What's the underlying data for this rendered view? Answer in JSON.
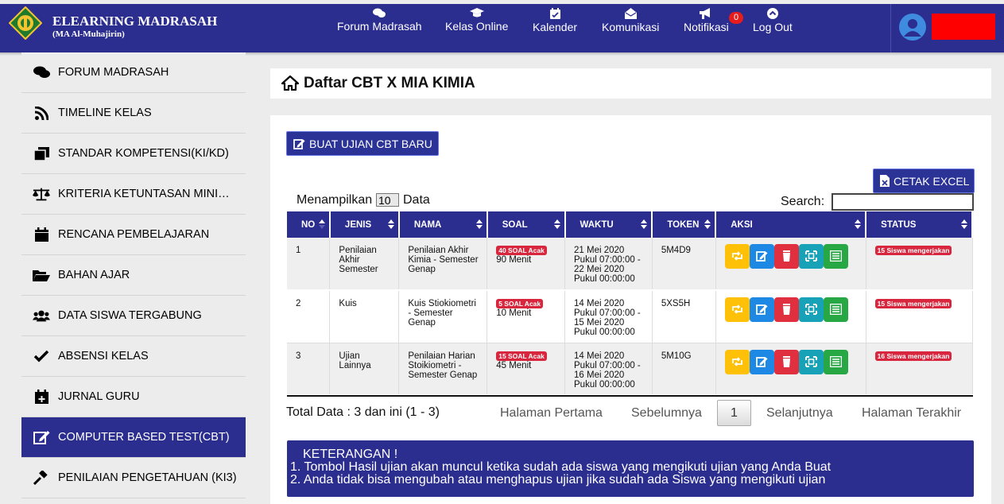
{
  "brand": {
    "title": "ELEARNING MADRASAH",
    "subtitle": "(MA Al-Muhajirin)"
  },
  "nav": {
    "items": [
      {
        "label": "Forum Madrasah",
        "icon": "comments-icon"
      },
      {
        "label": "Kelas Online",
        "icon": "graduation-cap-icon"
      },
      {
        "label": "Kalender",
        "icon": "calendar-check-icon"
      },
      {
        "label": "Komunikasi",
        "icon": "envelope-open-icon"
      },
      {
        "label": "Notifikasi",
        "icon": "bullhorn-icon"
      },
      {
        "label": "Log Out",
        "icon": "chevron-circle-up-icon"
      }
    ],
    "notif_count": "0"
  },
  "sidebar": {
    "items": [
      {
        "label": "FORUM MADRASAH",
        "icon": "comments-icon"
      },
      {
        "label": "TIMELINE KELAS",
        "icon": "rss-icon"
      },
      {
        "label": "STANDAR KOMPETENSI(KI/KD)",
        "icon": "clone-icon"
      },
      {
        "label": "KRITERIA KETUNTASAN MINI…",
        "icon": "balance-scale-icon"
      },
      {
        "label": "RENCANA PEMBELAJARAN",
        "icon": "calendar-icon"
      },
      {
        "label": "BAHAN AJAR",
        "icon": "folder-open-icon"
      },
      {
        "label": "DATA SISWA TERGABUNG",
        "icon": "users-icon"
      },
      {
        "label": "ABSENSI KELAS",
        "icon": "check-icon"
      },
      {
        "label": "JURNAL GURU",
        "icon": "calendar-plus-icon"
      },
      {
        "label": "COMPUTER BASED TEST(CBT)",
        "icon": "edit-icon",
        "active": true
      },
      {
        "label": "PENILAIAN PENGETAHUAN (KI3)",
        "icon": "gavel-icon"
      }
    ]
  },
  "page": {
    "title": "Daftar CBT X MIA KIMIA"
  },
  "toolbar": {
    "new_label": "BUAT UJIAN CBT BARU",
    "excel_label": "CETAK EXCEL"
  },
  "table_controls": {
    "show_prefix": "Menampilkan",
    "show_value": "10",
    "show_suffix": "Data",
    "search_label": "Search:"
  },
  "table": {
    "headers": [
      "NO",
      "JENIS",
      "NAMA",
      "SOAL",
      "WAKTU",
      "TOKEN",
      "AKSI",
      "STATUS"
    ],
    "rows": [
      {
        "no": "1",
        "jenis": "Penilaian Akhir Semester",
        "nama": "Penilaian Akhir Kimia - Semester Genap",
        "soal_badge": "40 SOAL Acak",
        "soal_menit": "90 Menit",
        "waktu": "21 Mei 2020 Pukul 07:00:00 - 22 Mei 2020 Pukul 00:00:00",
        "token": "5M4D9",
        "status": "15 Siswa mengerjakan"
      },
      {
        "no": "2",
        "jenis": "Kuis",
        "nama": "Kuis Stiokiometri - Semester Genap",
        "soal_badge": "5 SOAL Acak",
        "soal_menit": "10 Menit",
        "waktu": "14 Mei 2020 Pukul 07:00:00 - 15 Mei 2020 Pukul 00:00:00",
        "token": "5XS5H",
        "status": "15 Siswa mengerjakan"
      },
      {
        "no": "3",
        "jenis": "Ujian Lainnya",
        "nama": "Penilaian Harian Stoikiometri - Semester Genap",
        "soal_badge": "15 SOAL Acak",
        "soal_menit": "45 Menit",
        "waktu": "14 Mei 2020 Pukul 07:00:00 - 16 Mei 2020 Pukul 00:00:00",
        "token": "5M10G",
        "status": "16 Siswa mengerjakan"
      }
    ]
  },
  "footer": {
    "total": "Total Data : 3 dan ini (1 - 3)",
    "first": "Halaman Pertama",
    "prev": "Sebelumnya",
    "current": "1",
    "next": "Selanjutnya",
    "last": "Halaman Terakhir"
  },
  "note": {
    "title": "KETERANGAN !",
    "line1": "1. Tombol Hasil ujian akan muncul ketika sudah ada siswa yang mengikuti ujian yang Anda Buat",
    "line2": "2. Anda tidak bisa mengubah atau menghapus ujian jika sudah ada Siswa yang mengikuti ujian"
  },
  "colors": {
    "primary": "#2b2d8f",
    "danger": "#d7263d",
    "warning": "#ffc107",
    "info": "#17a2b8",
    "success": "#28a745",
    "blue": "#1e88e5"
  }
}
